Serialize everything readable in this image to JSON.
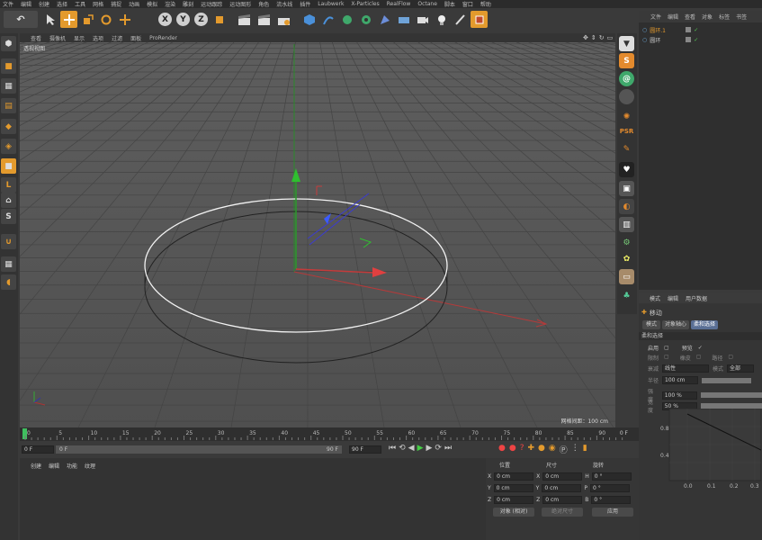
{
  "menu": [
    "文件",
    "编辑",
    "创建",
    "选择",
    "工具",
    "网格",
    "捕捉",
    "动画",
    "模拟",
    "渲染",
    "雕刻",
    "运动跟踪",
    "运动图形",
    "角色",
    "流水线",
    "插件",
    "Laubwerk",
    "X-Particles",
    "RealFlow",
    "Octane",
    "脚本",
    "窗口",
    "帮助"
  ],
  "toolbar": {
    "undo": "↶",
    "axes": [
      "X",
      "Y",
      "Z"
    ]
  },
  "viewport": {
    "menu": [
      "查看",
      "摄像机",
      "显示",
      "选项",
      "过滤",
      "面板",
      "ProRender"
    ],
    "label": "透视视图",
    "grid_info": "网格间距：100 cm"
  },
  "object_manager": {
    "tabs": [
      "文件",
      "编辑",
      "查看",
      "对象",
      "标签",
      "书签"
    ],
    "objects": [
      {
        "name": "圆环.1",
        "selected": true
      },
      {
        "name": "圆环",
        "selected": false
      }
    ]
  },
  "attributes": {
    "tabs": [
      "模式",
      "编辑",
      "用户数据"
    ],
    "tool_title": "移动",
    "subtabs": [
      "模式",
      "对象轴心",
      "柔和选择"
    ],
    "section": "柔和选择",
    "rows": [
      {
        "label": "启用",
        "extra_label": "预览"
      },
      {
        "label": "限制",
        "extra_label": "橡皮",
        "extra2": "路径"
      },
      {
        "label": "衰减",
        "value": "线性",
        "extra_label": "模式",
        "extra_value": "全部"
      },
      {
        "label": "半径",
        "value": "100 cm"
      },
      {
        "label": "强度",
        "value": "100 %"
      },
      {
        "label": "宽度",
        "value": "50 %"
      }
    ],
    "graph": {
      "y_ticks": [
        "0.8",
        "0.4"
      ],
      "x_ticks": [
        "0.0",
        "0.1",
        "0.2",
        "0.3"
      ]
    }
  },
  "timeline": {
    "ticks": [
      "0",
      "5",
      "10",
      "15",
      "20",
      "25",
      "30",
      "35",
      "40",
      "45",
      "50",
      "55",
      "60",
      "65",
      "70",
      "75",
      "80",
      "85",
      "90"
    ],
    "frame_end_label": "0 F",
    "start_field": "0 F",
    "current_field": "0 F",
    "end_field": "90 F",
    "max_field": "90 F"
  },
  "bottom_panel": {
    "tabs": [
      "创建",
      "编辑",
      "功能",
      "纹理"
    ]
  },
  "coords": {
    "headers": [
      "位置",
      "尺寸",
      "旋转"
    ],
    "rows": [
      {
        "axis": "X",
        "pos": "0 cm",
        "size": "0 cm",
        "rot_axis": "H",
        "rot": "0 °"
      },
      {
        "axis": "Y",
        "pos": "0 cm",
        "size": "0 cm",
        "rot_axis": "P",
        "rot": "0 °"
      },
      {
        "axis": "Z",
        "pos": "0 cm",
        "size": "0 cm",
        "rot_axis": "B",
        "rot": "0 °"
      }
    ],
    "mode": "对象 (相对)",
    "size_mode": "绝对尺寸",
    "apply": "应用"
  }
}
